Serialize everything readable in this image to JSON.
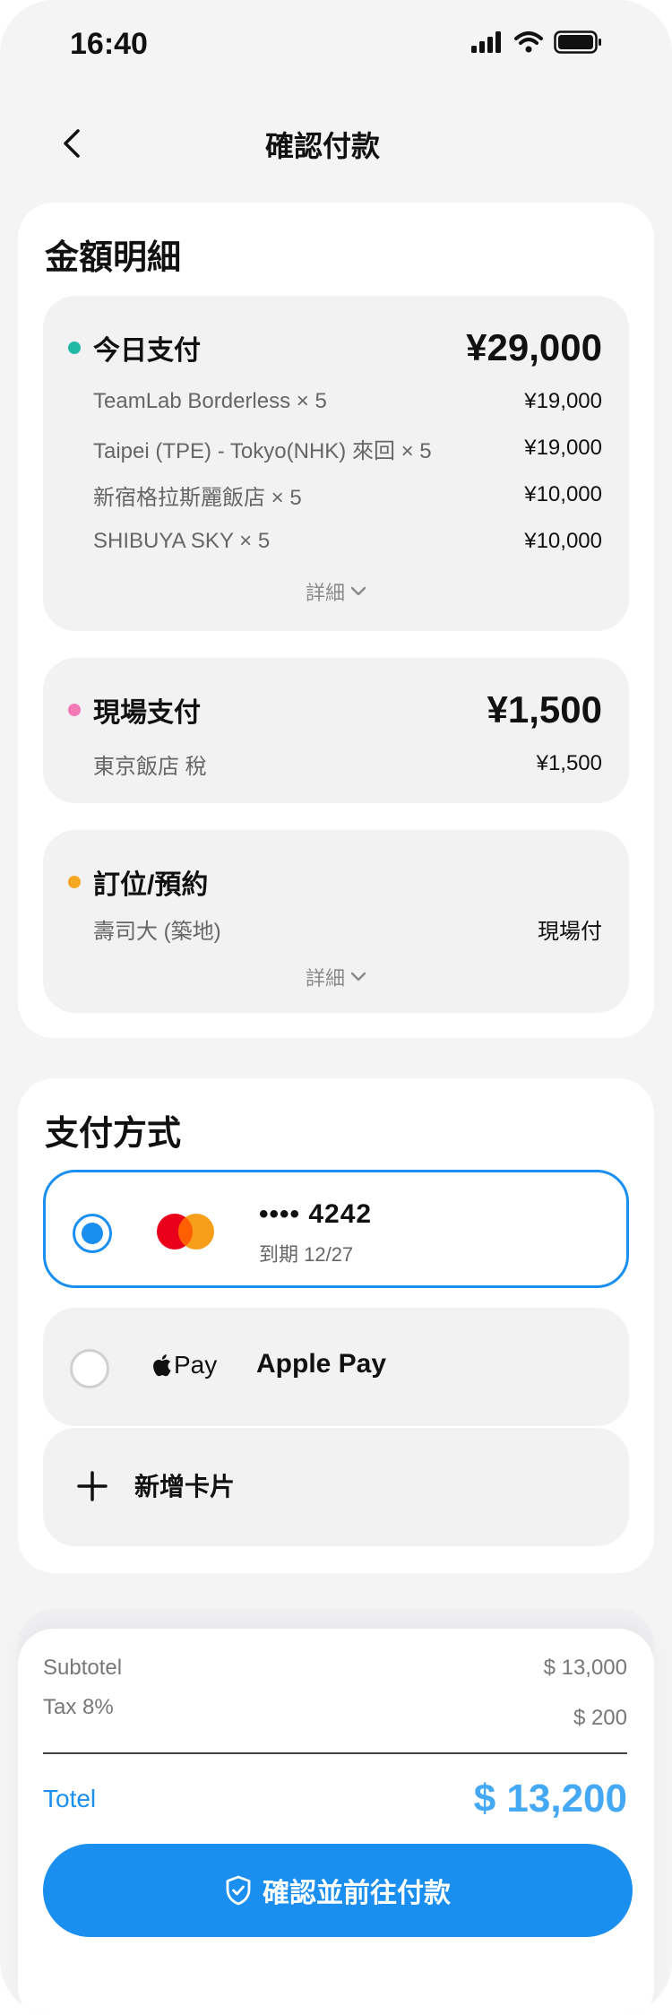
{
  "status": {
    "time": "16:40"
  },
  "header": {
    "title": "確認付款"
  },
  "amount_card": {
    "title": "金額明細",
    "today": {
      "label": "今日支付",
      "total": "¥29,000",
      "dot_color": "#22b8a6",
      "items": [
        {
          "name": "TeamLab Borderless × 5",
          "amount": "¥19,000"
        },
        {
          "name": "Taipei (TPE)  -  Tokyo(NHK) 來回 × 5",
          "amount": "¥19,000"
        },
        {
          "name": "新宿格拉斯麗飯店 × 5",
          "amount": "¥10,000"
        },
        {
          "name": "SHIBUYA SKY × 5",
          "amount": "¥10,000"
        }
      ],
      "details_label": "詳細"
    },
    "onsite": {
      "label": "現場支付",
      "total": "¥1,500",
      "dot_color": "#f27ab5",
      "items": [
        {
          "name": "東京飯店 稅",
          "amount": "¥1,500"
        }
      ]
    },
    "booking": {
      "label": "訂位/預約",
      "dot_color": "#f5a623",
      "items": [
        {
          "name": "壽司大 (築地)",
          "amount": "現場付"
        }
      ],
      "details_label": "詳細"
    }
  },
  "payment_card": {
    "title": "支付方式",
    "options": [
      {
        "type": "card",
        "brand_icon": "mastercard-icon",
        "number": "•••• 4242",
        "expiry": "到期 12/27",
        "selected": true
      },
      {
        "type": "applepay",
        "brand_icon": "apple-pay-icon",
        "logo_text": "Pay",
        "name": "Apple Pay",
        "selected": false
      }
    ],
    "add_card_label": "新增卡片"
  },
  "summary": {
    "subtotal_label": "Subtotel",
    "subtotal_value": "$ 13,000",
    "tax_label": "Tax 8%",
    "tax_value": "$ 200",
    "total_label": "Totel",
    "total_value": "$ 13,200",
    "cta_label": "確認並前往付款"
  },
  "colors": {
    "accent": "#1a8ff0",
    "total": "#44a8f5"
  }
}
